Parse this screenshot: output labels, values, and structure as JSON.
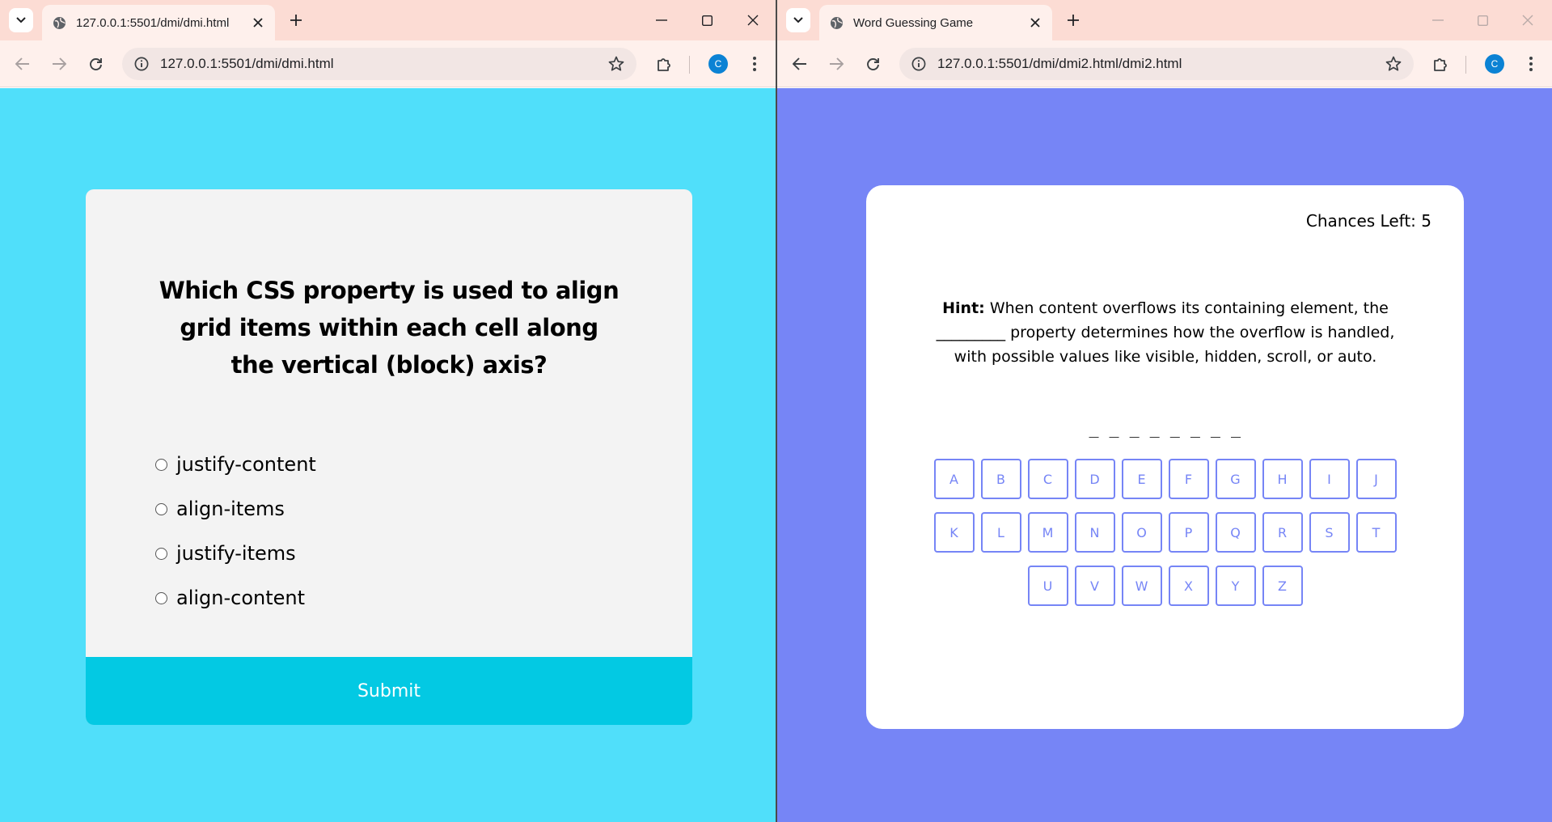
{
  "left_window": {
    "tab_title": "127.0.0.1:5501/dmi/dmi.html",
    "url": "127.0.0.1:5501/dmi/dmi.html",
    "profile_initial": "C",
    "quiz": {
      "question": "Which CSS property is used to align grid items within each cell along the vertical (block) axis?",
      "options": [
        "justify-content",
        "align-items",
        "justify-items",
        "align-content"
      ],
      "submit_label": "Submit"
    }
  },
  "right_window": {
    "tab_title": "Word Guessing Game",
    "url": "127.0.0.1:5501/dmi/dmi2.html/dmi2.html",
    "profile_initial": "C",
    "game": {
      "chances_label": "Chances Left: 5",
      "hint_label": "Hint:",
      "hint_text": "When content overflows its containing element, the _________ property determines how the overflow is handled, with possible values like visible, hidden, scroll, or auto.",
      "word_blanks": "_ _ _ _ _ _ _ _",
      "keyboard_rows": [
        [
          "A",
          "B",
          "C",
          "D",
          "E",
          "F",
          "G",
          "H",
          "I",
          "J"
        ],
        [
          "K",
          "L",
          "M",
          "N",
          "O",
          "P",
          "Q",
          "R",
          "S",
          "T"
        ],
        [
          "U",
          "V",
          "W",
          "X",
          "Y",
          "Z"
        ]
      ]
    }
  },
  "colors": {
    "quiz_background": "#50dffa",
    "quiz_card": "#f3f3f3",
    "submit_button": "#03c9e3",
    "game_background": "#7685f6",
    "game_key": "#7685f6",
    "tabstrip": "#fcdcd4",
    "toolbar": "#fef0ec",
    "avatar": "#0b82d4"
  },
  "icons": [
    "tab-list-icon",
    "globe-icon",
    "close-icon",
    "plus-icon",
    "minimize-icon",
    "maximize-icon",
    "back-icon",
    "forward-icon",
    "reload-icon",
    "info-icon",
    "star-icon",
    "extensions-icon",
    "menu-icon"
  ]
}
